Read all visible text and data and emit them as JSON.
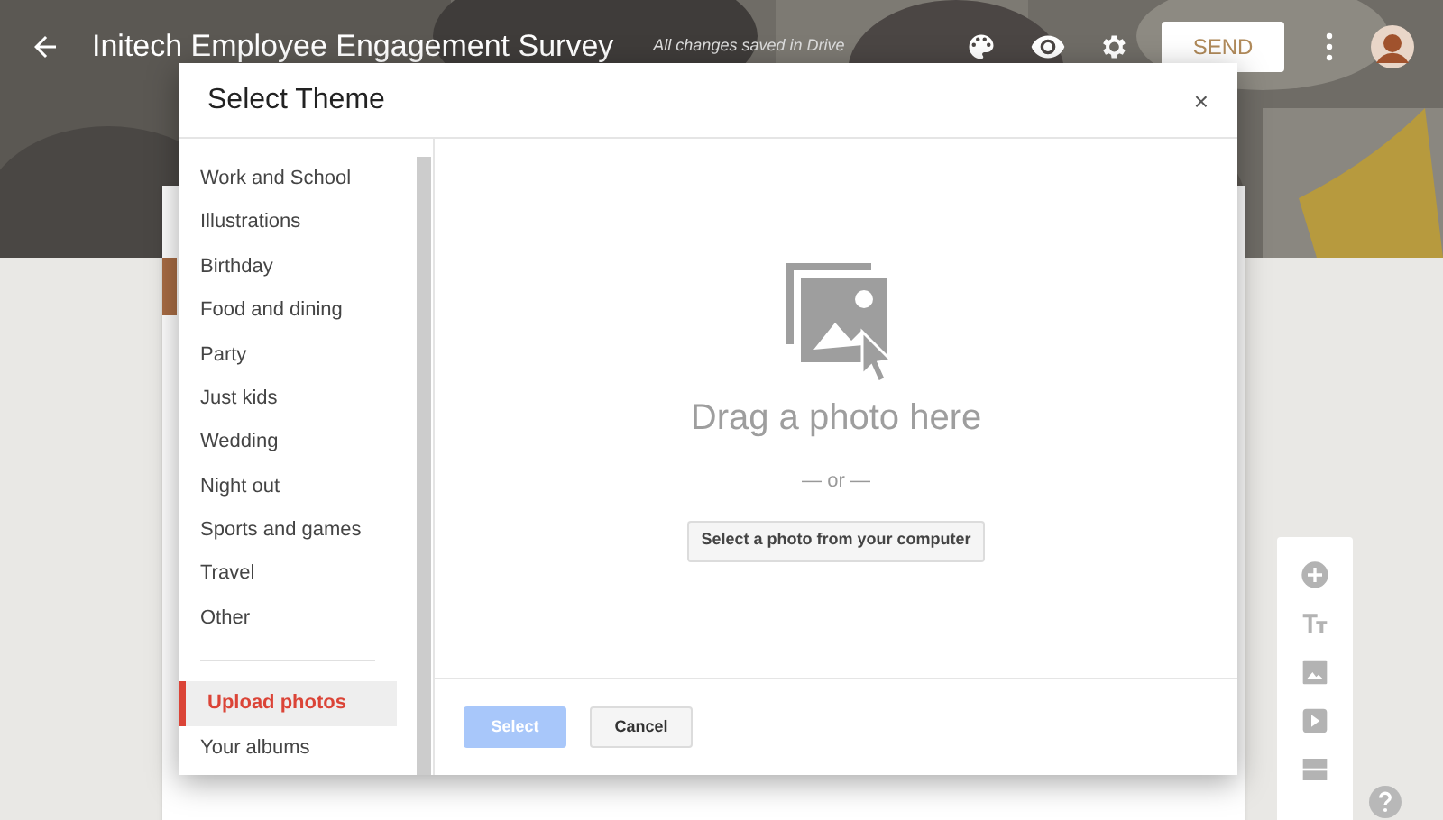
{
  "header": {
    "title": "Initech Employee Engagement Survey",
    "status": "All changes saved in Drive",
    "send_button": "SEND"
  },
  "dialog": {
    "title": "Select Theme",
    "close": "×",
    "categories": [
      {
        "label": "Work and School",
        "selected": false
      },
      {
        "label": "Illustrations",
        "selected": false
      },
      {
        "label": "Birthday",
        "selected": false
      },
      {
        "label": "Food and dining",
        "selected": false
      },
      {
        "label": "Party",
        "selected": false
      },
      {
        "label": "Just kids",
        "selected": false
      },
      {
        "label": "Wedding",
        "selected": false
      },
      {
        "label": "Night out",
        "selected": false
      },
      {
        "label": "Sports and games",
        "selected": false
      },
      {
        "label": "Travel",
        "selected": false
      },
      {
        "label": "Other",
        "selected": false
      }
    ],
    "sources": [
      {
        "label": "Upload photos",
        "selected": true
      },
      {
        "label": "Your albums",
        "selected": false
      }
    ],
    "drop_zone": {
      "heading": "Drag a photo here",
      "separator": "— or —",
      "button": "Select a photo from your computer"
    },
    "buttons": [
      {
        "label": "Select",
        "disabled": true
      },
      {
        "label": "Cancel",
        "disabled": false
      }
    ]
  }
}
